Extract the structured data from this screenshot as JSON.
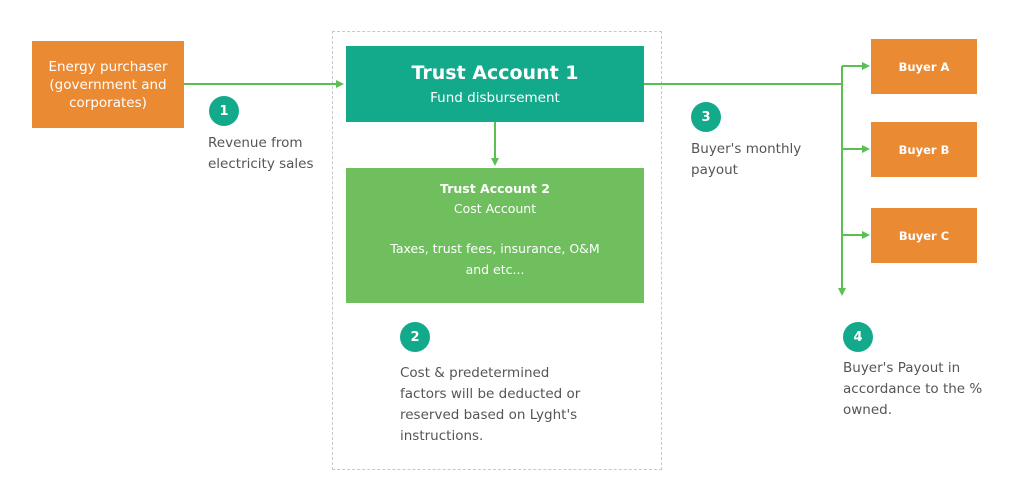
{
  "nodes": {
    "purchaser": "Energy purchaser (government and corporates)",
    "trust1_title": "Trust Account 1",
    "trust1_sub": "Fund disbursement",
    "trust2_title": "Trust Account 2",
    "trust2_sub": "Cost Account",
    "trust2_desc": "Taxes, trust fees, insurance, O&M and etc...",
    "buyers": [
      "Buyer A",
      "Buyer B",
      "Buyer C"
    ]
  },
  "steps": [
    {
      "num": "1",
      "text": "Revenue from electricity sales"
    },
    {
      "num": "2",
      "text": "Cost & predetermined factors will be deducted or reserved based on Lyght's instructions."
    },
    {
      "num": "3",
      "text": "Buyer's monthly payout"
    },
    {
      "num": "4",
      "text": "Buyer's Payout in accordance to the % owned."
    }
  ],
  "colors": {
    "orange": "#ea8a32",
    "teal": "#13a98b",
    "green": "#70bf5f",
    "arrow": "#5bbf52"
  }
}
